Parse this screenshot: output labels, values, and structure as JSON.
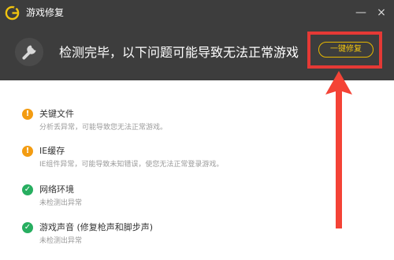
{
  "window": {
    "title": "游戏修复",
    "minimize_glyph": "—",
    "close_glyph": "×"
  },
  "header": {
    "headline": "检测完毕，以下问题可能导致无法正常游戏",
    "fix_button_label": "一键修复"
  },
  "issues": [
    {
      "title": "关键文件",
      "desc": "分析丢异常，可能导致您无法正常游戏。",
      "status": "warning",
      "icon": "exclamation-icon"
    },
    {
      "title": "IE缓存",
      "desc": "IE组件异常，可能导致未知错误，使您无法正常登录游戏。",
      "status": "warning",
      "icon": "exclamation-icon"
    },
    {
      "title": "网络环境",
      "desc": "未检测出异常",
      "status": "ok",
      "icon": "check-icon"
    },
    {
      "title": "游戏声音 (修复枪声和脚步声)",
      "desc": "未检测出异常",
      "status": "ok",
      "icon": "check-icon"
    }
  ],
  "colors": {
    "header_bg": "#3d3d3d",
    "accent_gold": "#f1c40f",
    "warning": "#f39c12",
    "ok": "#27ae60",
    "highlight": "#e53935"
  }
}
